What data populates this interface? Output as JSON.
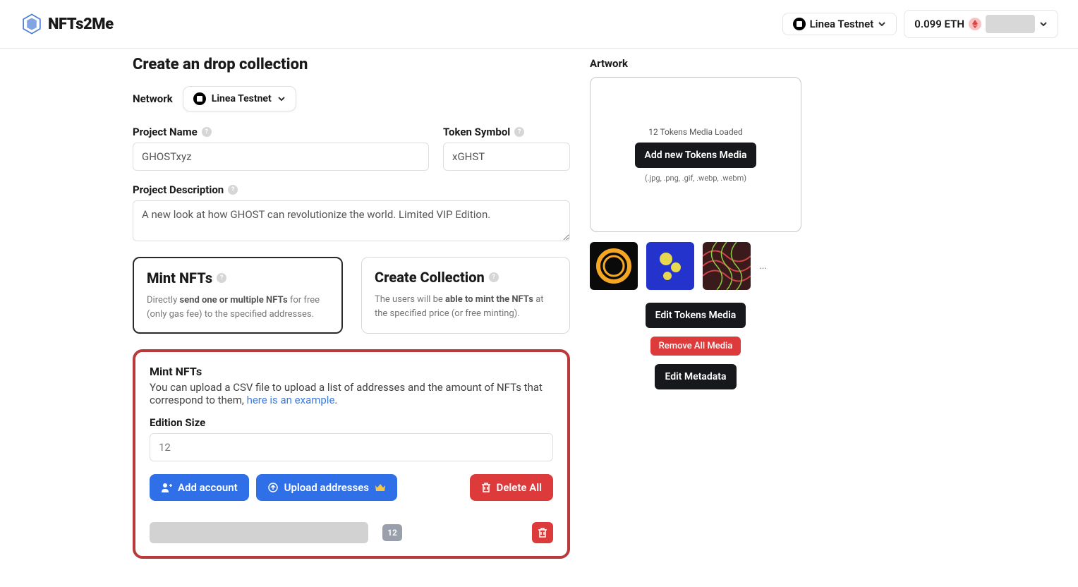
{
  "header": {
    "logo_text": "NFTs2Me",
    "network": "Linea Testnet",
    "balance": "0.099 ETH"
  },
  "page": {
    "title": "Create an drop collection",
    "network_label": "Network",
    "network_value": "Linea Testnet"
  },
  "form": {
    "project_name_label": "Project Name",
    "project_name_value": "GHOSTxyz",
    "token_symbol_label": "Token Symbol",
    "token_symbol_value": "xGHST",
    "description_label": "Project Description",
    "description_value": "A new look at how GHOST can revolutionize the world. Limited VIP Edition."
  },
  "options": {
    "mint": {
      "title": "Mint NFTs",
      "desc_prefix": "Directly ",
      "desc_strong": "send one or multiple NFTs",
      "desc_suffix": " for free (only gas fee) to the specified addresses."
    },
    "create": {
      "title": "Create Collection",
      "desc_prefix": "The users will be ",
      "desc_strong": "able to mint the NFTs",
      "desc_suffix": " at the specified price (or free minting)."
    }
  },
  "mint_section": {
    "title": "Mint NFTs",
    "desc_prefix": "You can upload a CSV file to upload a list of addresses and the amount of NFTs that correspond to them, ",
    "csv_link": "here is an example",
    "edition_size_label": "Edition Size",
    "edition_size_placeholder": "12",
    "add_account": "Add account",
    "upload_addresses": "Upload addresses",
    "delete_all": "Delete All",
    "row_count": "12"
  },
  "artwork": {
    "label": "Artwork",
    "status": "12 Tokens Media Loaded",
    "add_btn": "Add new Tokens Media",
    "hint": "(.jpg, .png, .gif, .webp, .webm)",
    "more": "...",
    "edit_tokens": "Edit Tokens Media",
    "remove_all": "Remove All Media",
    "edit_metadata": "Edit Metadata"
  }
}
